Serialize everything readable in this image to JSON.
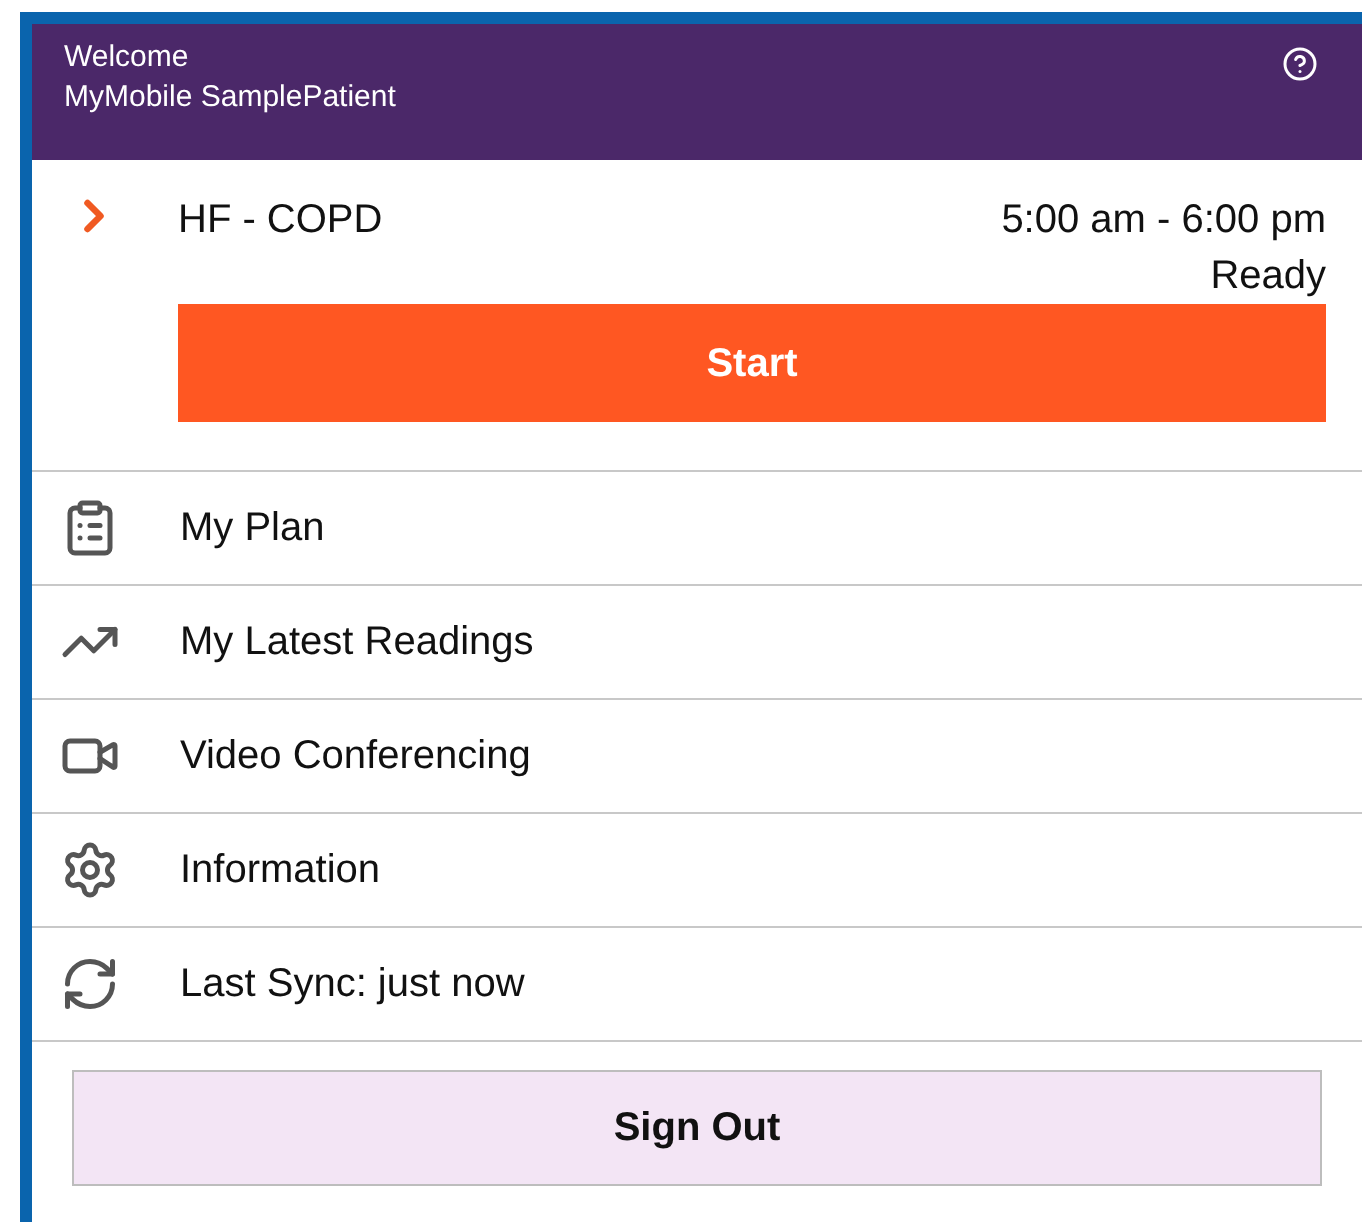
{
  "header": {
    "greeting": "Welcome",
    "patient_name": "MyMobile SamplePatient"
  },
  "session": {
    "name": "HF - COPD",
    "time": "5:00 am - 6:00 pm",
    "status": "Ready",
    "start_button": "Start"
  },
  "menu": [
    {
      "kind": "plan",
      "label": "My Plan"
    },
    {
      "kind": "readings",
      "label": "My Latest Readings"
    },
    {
      "kind": "video",
      "label": "Video Conferencing"
    },
    {
      "kind": "info",
      "label": "Information"
    },
    {
      "kind": "sync",
      "label": "Last Sync: just now"
    }
  ],
  "sign_out": "Sign Out"
}
